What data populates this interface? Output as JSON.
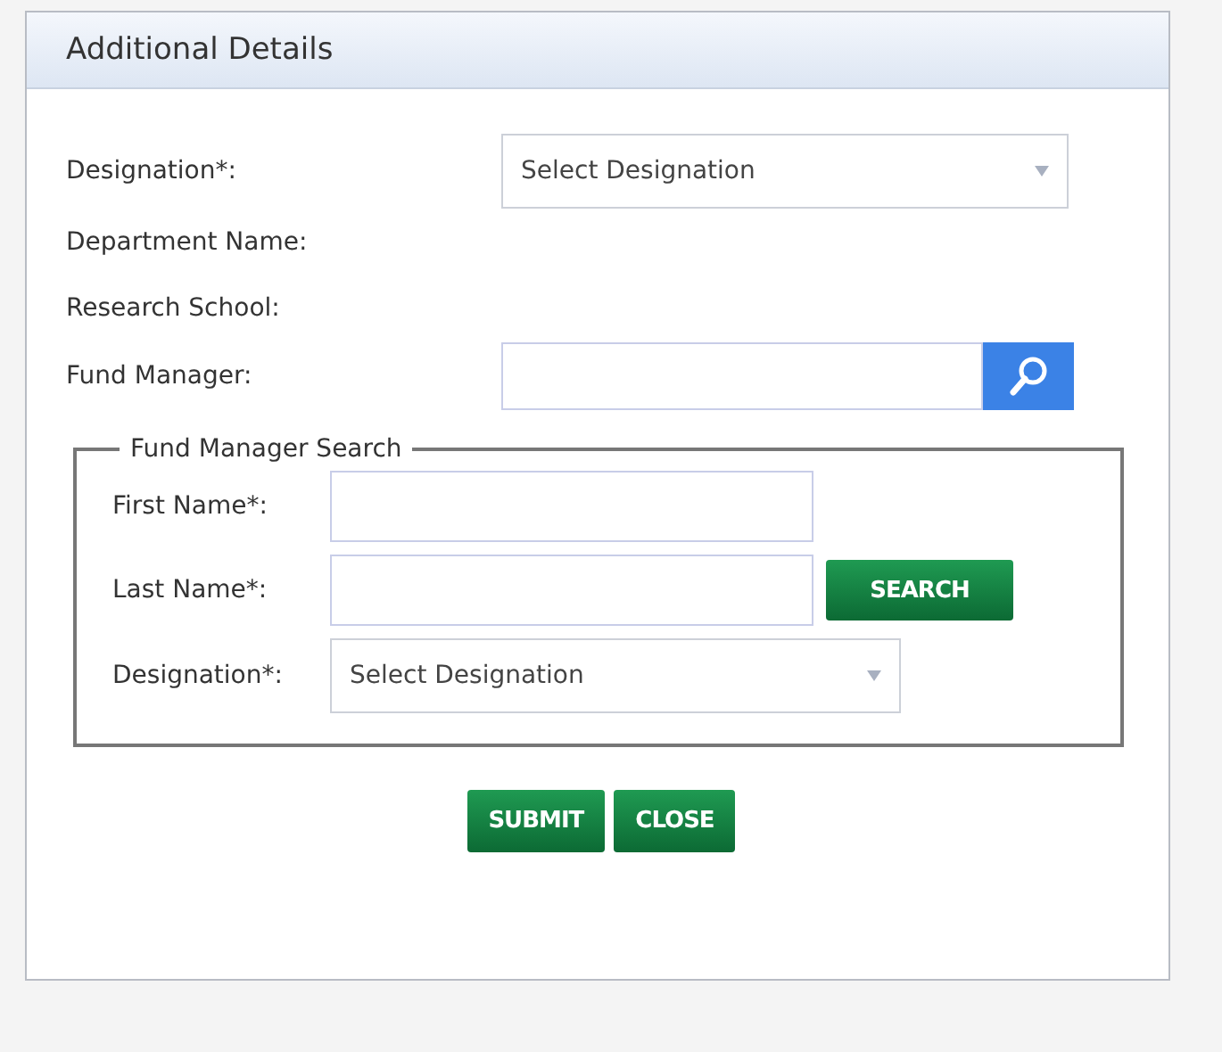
{
  "dialog": {
    "title": "Additional Details"
  },
  "fields": [
    {
      "kind": "select",
      "label": "Designation*:",
      "placeholder": "Select Designation"
    },
    {
      "kind": "text",
      "label": "Department Name:"
    },
    {
      "kind": "text",
      "label": "Research School:"
    },
    {
      "kind": "lookup",
      "label": "Fund Manager:"
    }
  ],
  "search_group": {
    "legend": "Fund Manager Search",
    "fields": [
      {
        "kind": "input",
        "label": "First Name*:"
      },
      {
        "kind": "input_button",
        "label": "Last Name*:",
        "button": "SEARCH"
      },
      {
        "kind": "select",
        "label": "Designation*:",
        "placeholder": "Select Designation"
      }
    ]
  },
  "buttons": [
    "SUBMIT",
    "CLOSE"
  ]
}
